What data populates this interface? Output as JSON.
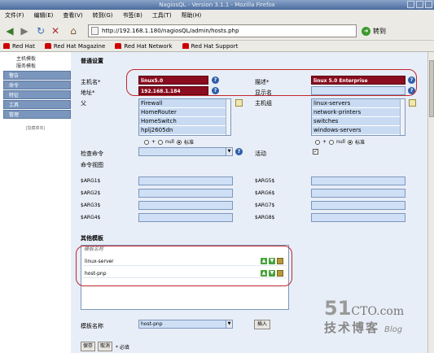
{
  "window": {
    "title": "NagiosQL - Version 3.1.1 - Mozilla Firefox"
  },
  "menu": [
    "文件(F)",
    "编辑(E)",
    "查看(V)",
    "转到(G)",
    "书签(B)",
    "工具(T)",
    "帮助(H)"
  ],
  "nav": {
    "url": "http://192.168.1.180/nagiosQL/admin/hosts.php",
    "go_label": "转到"
  },
  "bookmarks": [
    "Red Hat",
    "Red Hat Magazine",
    "Red Hat Network",
    "Red Hat Support"
  ],
  "sidebar": {
    "sub_items": [
      "主机模板",
      "服务模板"
    ],
    "items": [
      "警告",
      "命令",
      "特征",
      "工具",
      "管理"
    ],
    "collapse": "[隐藏菜单]"
  },
  "form": {
    "section_general": "普通设置",
    "host_name_label": "主机名*",
    "host_name_value": "linux5.0",
    "description_label": "描述*",
    "description_value": "linux 5.0 Enterprise",
    "address_label": "地址*",
    "address_value": "192.168.1.184",
    "display_name_label": "显示名",
    "display_name_value": "",
    "parents_label": "父",
    "parents_options": [
      "Firewall",
      "HomeRouter",
      "HomeSwitch",
      "hplj2605dn"
    ],
    "hostgroups_label": "主机组",
    "hostgroups_options": [
      "linux-servers",
      "network-printers",
      "switches",
      "windows-servers"
    ],
    "radio_plus": "+",
    "radio_null": "null",
    "radio_standard": "标准",
    "check_command_label": "检查命令",
    "check_command_value": "",
    "active_label": "活动",
    "active_checked": "✓",
    "command_view_label": "命令视图",
    "args_left": [
      "$ARG1$",
      "$ARG2$",
      "$ARG3$",
      "$ARG4$"
    ],
    "args_right": [
      "$ARG5$",
      "$ARG6$",
      "$ARG7$",
      "$ARG8$"
    ],
    "section_templates": "其他模板",
    "templates_header": "模板名称",
    "templates": [
      "linux-server",
      "host-pnp"
    ],
    "template_select_label": "模板名称",
    "template_select_value": "host-pnp",
    "insert_button": "插入",
    "save_button": "保存",
    "cancel_button": "取消",
    "required_note": "* 必填"
  },
  "watermark": {
    "number": "51",
    "cto": "CTO.com",
    "sub": "技术博客",
    "blog": "Blog"
  },
  "colors": {
    "accent": "#7a96bd",
    "required_field": "#8a0c1e",
    "highlight": "#c1272d"
  }
}
